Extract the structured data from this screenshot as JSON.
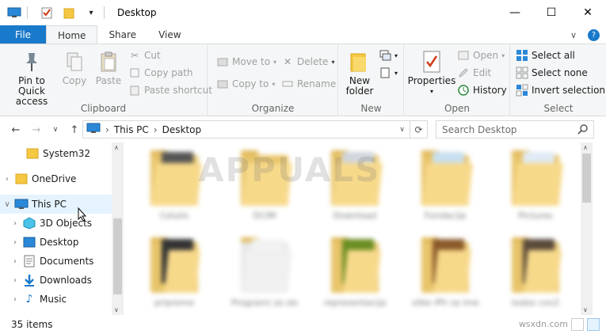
{
  "window": {
    "title": "Desktop",
    "controls": {
      "minimize": "—",
      "maximize": "☐",
      "close": "✕"
    }
  },
  "ribbon_tabs": [
    {
      "label": "File"
    },
    {
      "label": "Home"
    },
    {
      "label": "Share"
    },
    {
      "label": "View"
    }
  ],
  "clipboard": {
    "pin_line1": "Pin to Quick",
    "pin_line2": "access",
    "copy": "Copy",
    "paste": "Paste",
    "cut": "Cut",
    "copy_path": "Copy path",
    "paste_shortcut": "Paste shortcut",
    "label": "Clipboard"
  },
  "organize": {
    "move_to": "Move to",
    "copy_to": "Copy to",
    "delete": "Delete",
    "rename": "Rename",
    "label": "Organize"
  },
  "new_group": {
    "new_folder_line1": "New",
    "new_folder_line2": "folder",
    "label": "New"
  },
  "open_group": {
    "properties": "Properties",
    "open": "Open",
    "edit": "Edit",
    "history": "History",
    "label": "Open"
  },
  "select_group": {
    "select_all": "Select all",
    "select_none": "Select none",
    "invert_selection": "Invert selection",
    "label": "Select"
  },
  "address": {
    "path": [
      "This PC",
      "Desktop"
    ],
    "separator": "›",
    "search_placeholder": "Search Desktop"
  },
  "nav_pane": {
    "items": [
      {
        "label": "System32",
        "icon": "folder-icon"
      },
      {
        "label": "OneDrive",
        "icon": "folder-icon"
      },
      {
        "label": "This PC",
        "icon": "computer-icon"
      },
      {
        "label": "3D Objects",
        "icon": "cube-icon"
      },
      {
        "label": "Desktop",
        "icon": "desktop-icon"
      },
      {
        "label": "Documents",
        "icon": "documents-icon"
      },
      {
        "label": "Downloads",
        "icon": "download-arrow-icon"
      },
      {
        "label": "Music",
        "icon": "music-note-icon"
      }
    ]
  },
  "files": [
    {
      "label": "Celulis"
    },
    {
      "label": "DCIM"
    },
    {
      "label": "Download"
    },
    {
      "label": "Fondacija"
    },
    {
      "label": "Pictures"
    },
    {
      "label": "pripreme"
    },
    {
      "label": "Programi za skole"
    },
    {
      "label": "reprezentacija"
    },
    {
      "label": "slike iPh sa imenom"
    },
    {
      "label": "todos cov2"
    }
  ],
  "watermark": "APPUALS",
  "status": {
    "item_count": "35 items"
  },
  "credit": "wsxdn.com",
  "colors": {
    "file_tab": "#1979ca",
    "ribbon_bg": "#f5f6f7",
    "selected": "#e5f3ff",
    "folder": "#f7d98a"
  }
}
